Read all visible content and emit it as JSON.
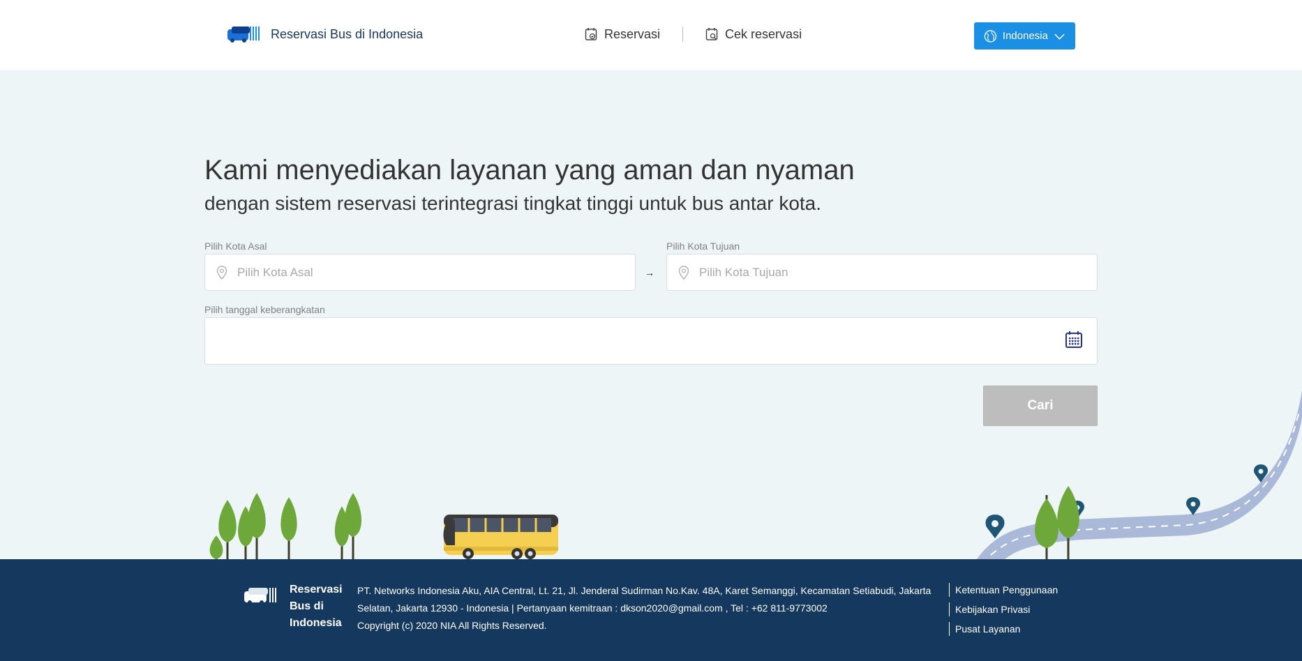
{
  "header": {
    "brand_name": "Reservasi Bus di Indonesia",
    "nav": [
      {
        "label": "Reservasi",
        "icon": "calendar-check-icon"
      },
      {
        "label": "Cek reservasi",
        "icon": "calendar-search-icon"
      }
    ],
    "language_button": {
      "label": "Indonesia",
      "icon": "globe-icon"
    }
  },
  "hero": {
    "title": "Kami menyediakan layanan yang aman dan nyaman",
    "subtitle": "dengan sistem reservasi terintegrasi tingkat tinggi untuk bus antar kota."
  },
  "form": {
    "origin": {
      "label": "Pilih Kota Asal",
      "placeholder": "Pilih Kota Asal",
      "value": ""
    },
    "destination": {
      "label": "Pilih Kota Tujuan",
      "placeholder": "Pilih Kota Tujuan",
      "value": ""
    },
    "arrow": "→",
    "date": {
      "label": "Pilih tanggal keberangkatan",
      "value": ""
    },
    "search_label": "Cari"
  },
  "colors": {
    "primary": "#1a8fe3",
    "brand_dark": "#16365c",
    "footer_bg": "#15395e",
    "page_bg": "#edf5f7",
    "button_disabled": "#bdbdbd"
  },
  "footer": {
    "brand_lines": [
      "Reservasi",
      "Bus di",
      "Indonesia"
    ],
    "address_lines": [
      "PT. Networks Indonesia Aku, AIA Central, Lt. 21, Jl. Jenderal Sudirman No.Kav. 48A, Karet Semanggi, Kecamatan Setiabudi, Jakarta",
      "Selatan, Jakarta 12930 - Indonesia | Pertanyaan kemitraan : dkson2020@gmail.com , Tel : +62 811-9773002",
      "Copyright (c) 2020 NIA All Rights Reserved."
    ],
    "links": [
      "Ketentuan Penggunaan",
      "Kebijakan Privasi",
      "Pusat Layanan"
    ]
  }
}
